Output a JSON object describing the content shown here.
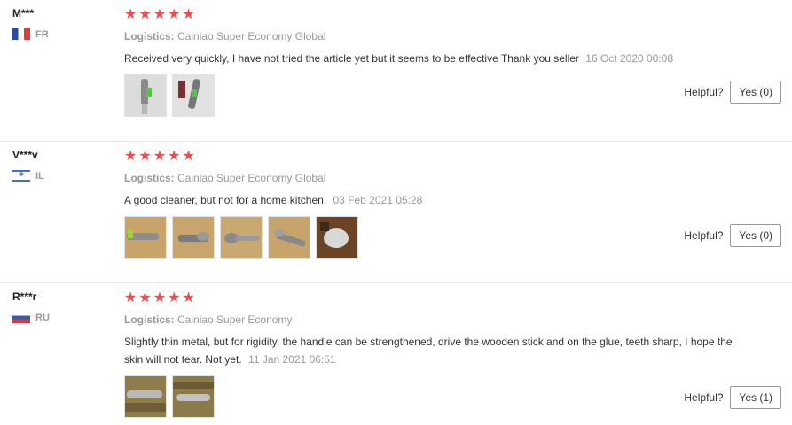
{
  "reviews": [
    {
      "user": "M***",
      "country": "FR",
      "stars": "★★★★★",
      "logistics_label": "Logistics:",
      "logistics": "Cainiao Super Economy Global",
      "text": "Received very quickly, I have not tried the article yet but it seems to be effective Thank you seller",
      "date": "16 Oct 2020 00:08",
      "helpful_label": "Helpful?",
      "yes_label": "Yes (0)"
    },
    {
      "user": "V***v",
      "country": "IL",
      "stars": "★★★★★",
      "logistics_label": "Logistics:",
      "logistics": "Cainiao Super Economy Global",
      "text": "A good cleaner, but not for a home kitchen.",
      "date": "03 Feb 2021 05:28",
      "helpful_label": "Helpful?",
      "yes_label": "Yes (0)"
    },
    {
      "user": "R***r",
      "country": "RU",
      "stars": "★★★★★",
      "logistics_label": "Logistics:",
      "logistics": "Cainiao Super Economy",
      "text": "Slightly thin metal, but for rigidity, the handle can be strengthened, drive the wooden stick and on the glue, teeth sharp, I hope the skin will not tear. Not yet.",
      "date": "11 Jan 2021 06:51",
      "helpful_label": "Helpful?",
      "yes_label": "Yes (1)"
    }
  ]
}
